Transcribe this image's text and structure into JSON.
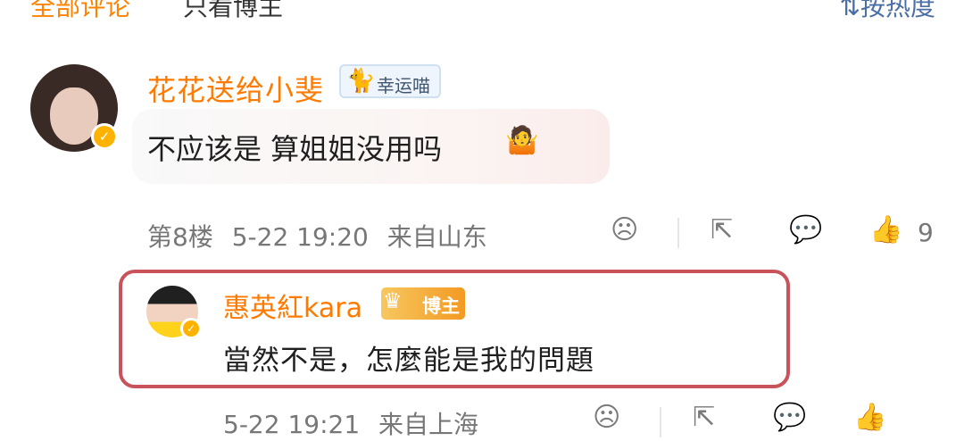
{
  "tabs": {
    "all_comments": "全部评论",
    "author_only": "只看博主"
  },
  "sort": {
    "label": "按热度",
    "icon": "sort-icon"
  },
  "comment": {
    "username": "花花送给小斐",
    "badge": "幸运喵",
    "text": "不应该是 算姐姐没用吗",
    "floor": "第8楼",
    "time": "5-22 19:20",
    "location": "来自山东",
    "likes": "9"
  },
  "reply": {
    "username": "惠英紅kara",
    "badge": "博主",
    "text": "當然不是，怎麼能是我的問題",
    "time": "5-22 19:21",
    "location": "来自上海"
  },
  "colors": {
    "username": "#ff7a00",
    "highlight_border": "#c9535a",
    "verify": "#ffb300"
  }
}
